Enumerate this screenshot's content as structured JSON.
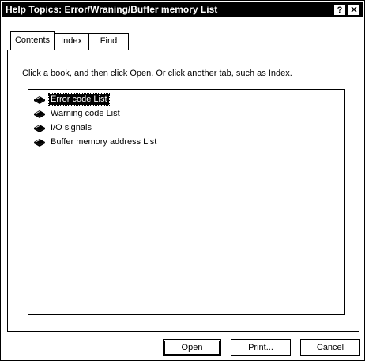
{
  "window": {
    "title": "Help Topics: Error/Wraning/Buffer memory List",
    "help_button": "?",
    "close_button": "✕"
  },
  "tabs": [
    {
      "label": "Contents",
      "active": true
    },
    {
      "label": "Index",
      "active": false
    },
    {
      "label": "Find",
      "active": false
    }
  ],
  "instruction": "Click a book, and then click Open. Or click another tab, such as Index.",
  "tree": {
    "items": [
      {
        "label": "Error code List",
        "icon": "book-icon",
        "selected": true
      },
      {
        "label": "Warning code List",
        "icon": "book-icon",
        "selected": false
      },
      {
        "label": "I/O signals",
        "icon": "book-icon",
        "selected": false
      },
      {
        "label": "Buffer memory address List",
        "icon": "book-icon",
        "selected": false
      }
    ]
  },
  "buttons": {
    "open": "Open",
    "print": "Print...",
    "cancel": "Cancel"
  }
}
